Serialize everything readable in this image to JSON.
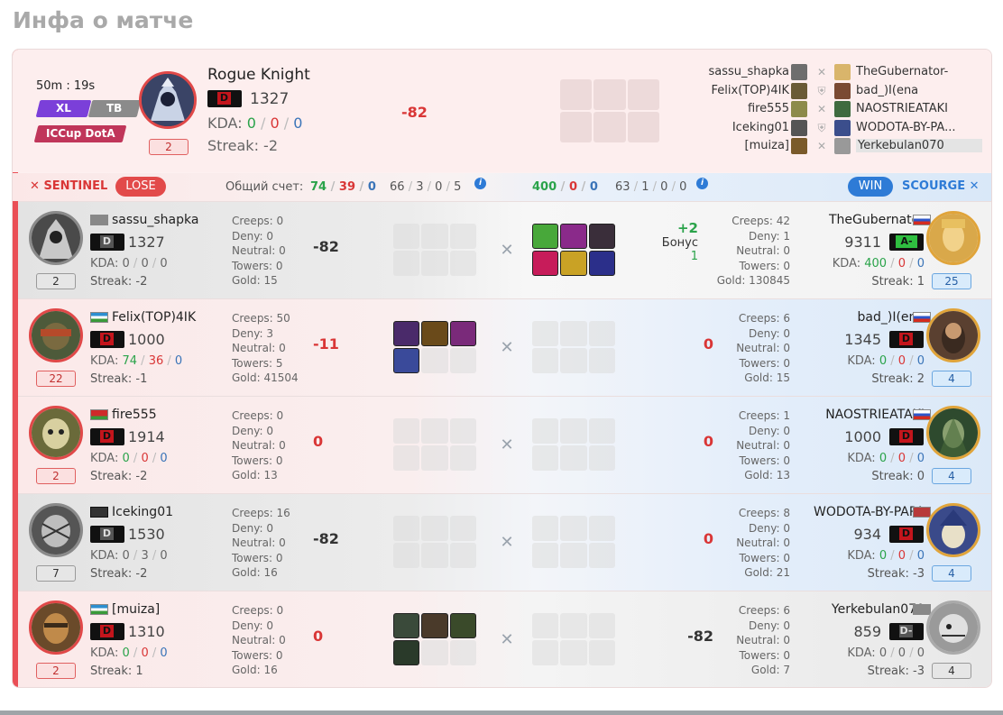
{
  "page": {
    "title": "Инфа о матче"
  },
  "header": {
    "duration": "50m : 19s",
    "tags": [
      "XL",
      "TB",
      "ICCup DotA"
    ],
    "hero_name": "Rogue Knight",
    "level": "2",
    "rank": "D",
    "rating": "1327",
    "kda_label": "KDA:",
    "kda": [
      "0",
      "0",
      "0"
    ],
    "streak": "Streak: -2",
    "delta": "-82",
    "roster": [
      {
        "left": "sassu_shapka",
        "right": "TheGubernator-",
        "hl": false
      },
      {
        "left": "Felix(TOP)4IK",
        "right": "bad_)I(ena",
        "hl": false
      },
      {
        "left": "fire555",
        "right": "NAOSTRIEATAKI",
        "hl": false
      },
      {
        "left": "Iceking01",
        "right": "WODOTA-BY-PA...",
        "hl": false
      },
      {
        "left": "[muiza]",
        "right": "Yerkebulan070",
        "hl": true
      }
    ]
  },
  "teambar": {
    "left_team": "SENTINEL",
    "left_result": "LOSE",
    "total_label": "Общий счет:",
    "total_left": [
      "74",
      "39",
      "0"
    ],
    "total_left_b": [
      "66",
      "3",
      "0",
      "5"
    ],
    "total_right": [
      "400",
      "0",
      "0"
    ],
    "total_right_b": [
      "63",
      "1",
      "0",
      "0"
    ],
    "info_icon": "i",
    "right_result": "WIN",
    "right_team": "SCOURGE"
  },
  "rows": [
    {
      "left": {
        "name": "sassu_shapka",
        "rank": "D",
        "rating": "1327",
        "kda": [
          "0",
          "0",
          "0"
        ],
        "streak": "Streak: -2",
        "level": "2",
        "stats": [
          "Creeps: 0",
          "Deny: 0",
          "Neutral: 0",
          "Towers: 0",
          "Gold: 15"
        ],
        "delta": "-82"
      },
      "right": {
        "name": "TheGubernator",
        "rank": "A-",
        "rating": "9311",
        "kda": [
          "400",
          "0",
          "0"
        ],
        "streak": "Streak: 1",
        "level": "25",
        "stats": [
          "Creeps: 42",
          "Deny: 1",
          "Neutral: 0",
          "Towers: 0",
          "Gold: 130845"
        ],
        "delta": "+2",
        "bonus_label": "Бонус",
        "bonus_value": "1"
      }
    },
    {
      "left": {
        "name": "Felix(TOP)4IK",
        "rank": "D",
        "rating": "1000",
        "kda": [
          "74",
          "36",
          "0"
        ],
        "streak": "Streak: -1",
        "level": "22",
        "stats": [
          "Creeps: 50",
          "Deny: 3",
          "Neutral: 0",
          "Towers: 5",
          "Gold: 41504"
        ],
        "delta": "-11"
      },
      "right": {
        "name": "bad_)I(ena",
        "rank": "D",
        "rating": "1345",
        "kda": [
          "0",
          "0",
          "0"
        ],
        "streak": "Streak: 2",
        "level": "4",
        "stats": [
          "Creeps: 6",
          "Deny: 0",
          "Neutral: 0",
          "Towers: 0",
          "Gold: 15"
        ],
        "delta": "0"
      }
    },
    {
      "left": {
        "name": "fire555",
        "rank": "D",
        "rating": "1914",
        "kda": [
          "0",
          "0",
          "0"
        ],
        "streak": "Streak: -2",
        "level": "2",
        "stats": [
          "Creeps: 0",
          "Deny: 0",
          "Neutral: 0",
          "Towers: 0",
          "Gold: 13"
        ],
        "delta": "0"
      },
      "right": {
        "name": "NAOSTRIEATAKI",
        "rank": "D",
        "rating": "1000",
        "kda": [
          "0",
          "0",
          "0"
        ],
        "streak": "Streak: 0",
        "level": "4",
        "stats": [
          "Creeps: 1",
          "Deny: 0",
          "Neutral: 0",
          "Towers: 0",
          "Gold: 13"
        ],
        "delta": "0"
      }
    },
    {
      "left": {
        "name": "Iceking01",
        "rank": "D",
        "rating": "1530",
        "kda": [
          "0",
          "3",
          "0"
        ],
        "streak": "Streak: -2",
        "level": "7",
        "stats": [
          "Creeps: 16",
          "Deny: 0",
          "Neutral: 0",
          "Towers: 0",
          "Gold: 16"
        ],
        "delta": "-82"
      },
      "right": {
        "name": "WODOTA-BY-PAPA",
        "rank": "D",
        "rating": "934",
        "kda": [
          "0",
          "0",
          "0"
        ],
        "streak": "Streak: -3",
        "level": "4",
        "stats": [
          "Creeps: 8",
          "Deny: 0",
          "Neutral: 0",
          "Towers: 0",
          "Gold: 21"
        ],
        "delta": "0"
      }
    },
    {
      "left": {
        "name": "[muiza]",
        "rank": "D",
        "rating": "1310",
        "kda": [
          "0",
          "0",
          "0"
        ],
        "streak": "Streak: 1",
        "level": "2",
        "stats": [
          "Creeps: 0",
          "Deny: 0",
          "Neutral: 0",
          "Towers: 0",
          "Gold: 16"
        ],
        "delta": "0"
      },
      "right": {
        "name": "Yerkebulan070",
        "rank": "D-",
        "rating": "859",
        "kda": [
          "0",
          "0",
          "0"
        ],
        "streak": "Streak: -3",
        "level": "4",
        "stats": [
          "Creeps: 6",
          "Deny: 0",
          "Neutral: 0",
          "Towers: 0",
          "Gold: 7"
        ],
        "delta": "-82"
      }
    }
  ],
  "colors": {
    "lose": "#e24a4a",
    "win": "#2e7bd6",
    "green": "#2aa34a",
    "red": "#d93636"
  }
}
